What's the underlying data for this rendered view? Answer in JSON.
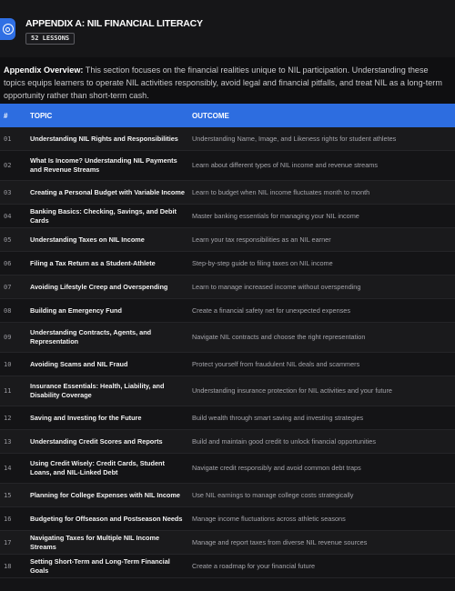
{
  "header": {
    "title": "APPENDIX A: NIL FINANCIAL LITERACY",
    "badge": "52 LESSONS"
  },
  "overview": {
    "label": "Appendix Overview:",
    "text": " This section focuses on the financial realities unique to NIL participation. Understanding these topics equips learners to operate NIL activities responsibly, avoid legal and financial pitfalls, and treat NIL as a long-term opportunity rather than short-term cash."
  },
  "table": {
    "columns": [
      "#",
      "TOPIC",
      "OUTCOME"
    ],
    "rows": [
      {
        "num": "01",
        "topic": "Understanding NIL Rights and Responsibilities",
        "outcome": "Understanding Name, Image, and Likeness rights for student athletes"
      },
      {
        "num": "02",
        "topic": "What Is Income? Understanding NIL Payments and Revenue Streams",
        "outcome": "Learn about different types of NIL income and revenue streams"
      },
      {
        "num": "03",
        "topic": "Creating a Personal Budget with Variable Income",
        "outcome": "Learn to budget when NIL income fluctuates month to month"
      },
      {
        "num": "04",
        "topic": "Banking Basics: Checking, Savings, and Debit Cards",
        "outcome": "Master banking essentials for managing your NIL income"
      },
      {
        "num": "05",
        "topic": "Understanding Taxes on NIL Income",
        "outcome": "Learn your tax responsibilities as an NIL earner"
      },
      {
        "num": "06",
        "topic": "Filing a Tax Return as a Student-Athlete",
        "outcome": "Step-by-step guide to filing taxes on NIL income"
      },
      {
        "num": "07",
        "topic": "Avoiding Lifestyle Creep and Overspending",
        "outcome": "Learn to manage increased income without overspending"
      },
      {
        "num": "08",
        "topic": "Building an Emergency Fund",
        "outcome": "Create a financial safety net for unexpected expenses"
      },
      {
        "num": "09",
        "topic": "Understanding Contracts, Agents, and Representation",
        "outcome": "Navigate NIL contracts and choose the right representation"
      },
      {
        "num": "10",
        "topic": "Avoiding Scams and NIL Fraud",
        "outcome": "Protect yourself from fraudulent NIL deals and scammers"
      },
      {
        "num": "11",
        "topic": "Insurance Essentials: Health, Liability, and Disability Coverage",
        "outcome": "Understanding insurance protection for NIL activities and your future"
      },
      {
        "num": "12",
        "topic": "Saving and Investing for the Future",
        "outcome": "Build wealth through smart saving and investing strategies"
      },
      {
        "num": "13",
        "topic": "Understanding Credit Scores and Reports",
        "outcome": "Build and maintain good credit to unlock financial opportunities"
      },
      {
        "num": "14",
        "topic": "Using Credit Wisely: Credit Cards, Student Loans, and NIL-Linked Debt",
        "outcome": "Navigate credit responsibly and avoid common debt traps"
      },
      {
        "num": "15",
        "topic": "Planning for College Expenses with NIL Income",
        "outcome": "Use NIL earnings to manage college costs strategically"
      },
      {
        "num": "16",
        "topic": "Budgeting for Offseason and Postseason Needs",
        "outcome": "Manage income fluctuations across athletic seasons"
      },
      {
        "num": "17",
        "topic": "Navigating Taxes for Multiple NIL Income Streams",
        "outcome": "Manage and report taxes from diverse NIL revenue sources"
      },
      {
        "num": "18",
        "topic": "Setting Short-Term and Long-Term Financial Goals",
        "outcome": "Create a roadmap for your financial future"
      }
    ]
  },
  "colors": {
    "accent": "#2d6de0",
    "background": "#141416"
  }
}
